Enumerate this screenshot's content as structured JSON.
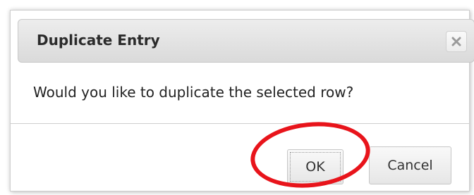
{
  "dialog": {
    "title": "Duplicate Entry",
    "close_label": "×",
    "message": "Would you like to duplicate the selected row?",
    "ok_label": "OK",
    "cancel_label": "Cancel"
  },
  "icons": {
    "close": "close-icon"
  },
  "colors": {
    "highlight": "#e8141b",
    "titlebar": "#e2e2e2",
    "border": "#c9c9c9"
  }
}
